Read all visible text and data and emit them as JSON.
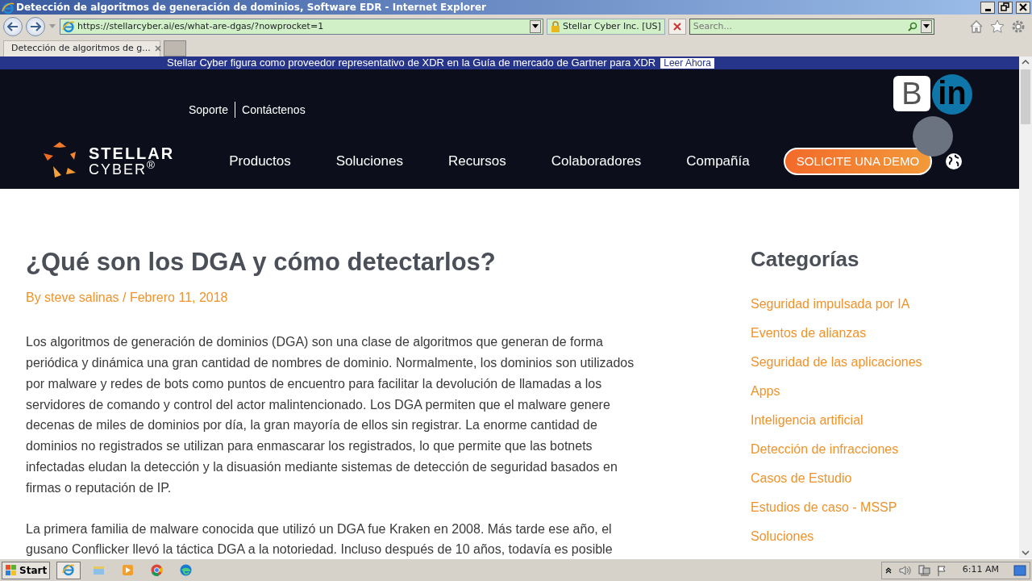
{
  "window": {
    "title": "Detección de algoritmos de generación de dominios, Software EDR - Internet Explorer"
  },
  "address_bar": {
    "url": "https://stellarcyber.ai/es/what-are-dgas/?nowprocket=1",
    "site_identity": "Stellar Cyber Inc. [US]",
    "search_placeholder": "Search..."
  },
  "tabs": [
    {
      "label": "Detección de algoritmos de g...",
      "selected": true,
      "loading": true
    }
  ],
  "page": {
    "banner": {
      "text": "Stellar Cyber figura como proveedor representativo de XDR en la Guía de mercado de Gartner para XDR",
      "link": "Leer Ahora"
    },
    "utility_links": [
      "Soporte",
      "Contáctenos"
    ],
    "logo": {
      "line1": "STELLAR",
      "line2": "CYBER$^{®}$"
    },
    "social": [
      "B",
      "in"
    ],
    "nav": [
      "Productos",
      "Soluciones",
      "Recursos",
      "Colaboradores",
      "Compañía"
    ],
    "cta": "SOLICITE UNA DEMO",
    "article": {
      "title": "¿Qué son los DGA y cómo detectarlos?",
      "meta": "By steve salinas / Febrero 11, 2018",
      "paragraphs": [
        "Los algoritmos de generación de dominios (DGA) son una clase de algoritmos que generan de forma periódica y dinámica una gran cantidad de nombres de dominio. Normalmente, los dominios son utilizados por malware y redes de bots como puntos de encuentro para facilitar la devolución de llamadas a los servidores de comando y control del actor malintencionado. Los DGA permiten que el malware genere decenas de miles de dominios por día, la gran mayoría de ellos sin registrar. La enorme cantidad de dominios no registrados se utilizan para enmascarar los registrados, lo que permite que las botnets infectadas eludan la detección y la disuasión mediante sistemas de detección de seguridad basados en firmas o reputación de IP.",
        "La primera familia de malware conocida que utilizó un DGA fue Kraken en 2008. Más tarde ese año, el gusano Conflicker llevó la táctica DGA a la notoriedad. Incluso después de 10 años, todavía es posible"
      ]
    },
    "sidebar": {
      "title": "Categorías",
      "items": [
        "Seguridad impulsada por IA",
        "Eventos de alianzas",
        "Seguridad de las aplicaciones",
        "Apps",
        "Inteligencia artificial",
        "Detección de infracciones",
        "Casos de Estudio",
        "Estudios de caso - MSSP",
        "Soluciones"
      ]
    }
  },
  "taskbar": {
    "start": "Start",
    "clock": "6:11 AM"
  }
}
